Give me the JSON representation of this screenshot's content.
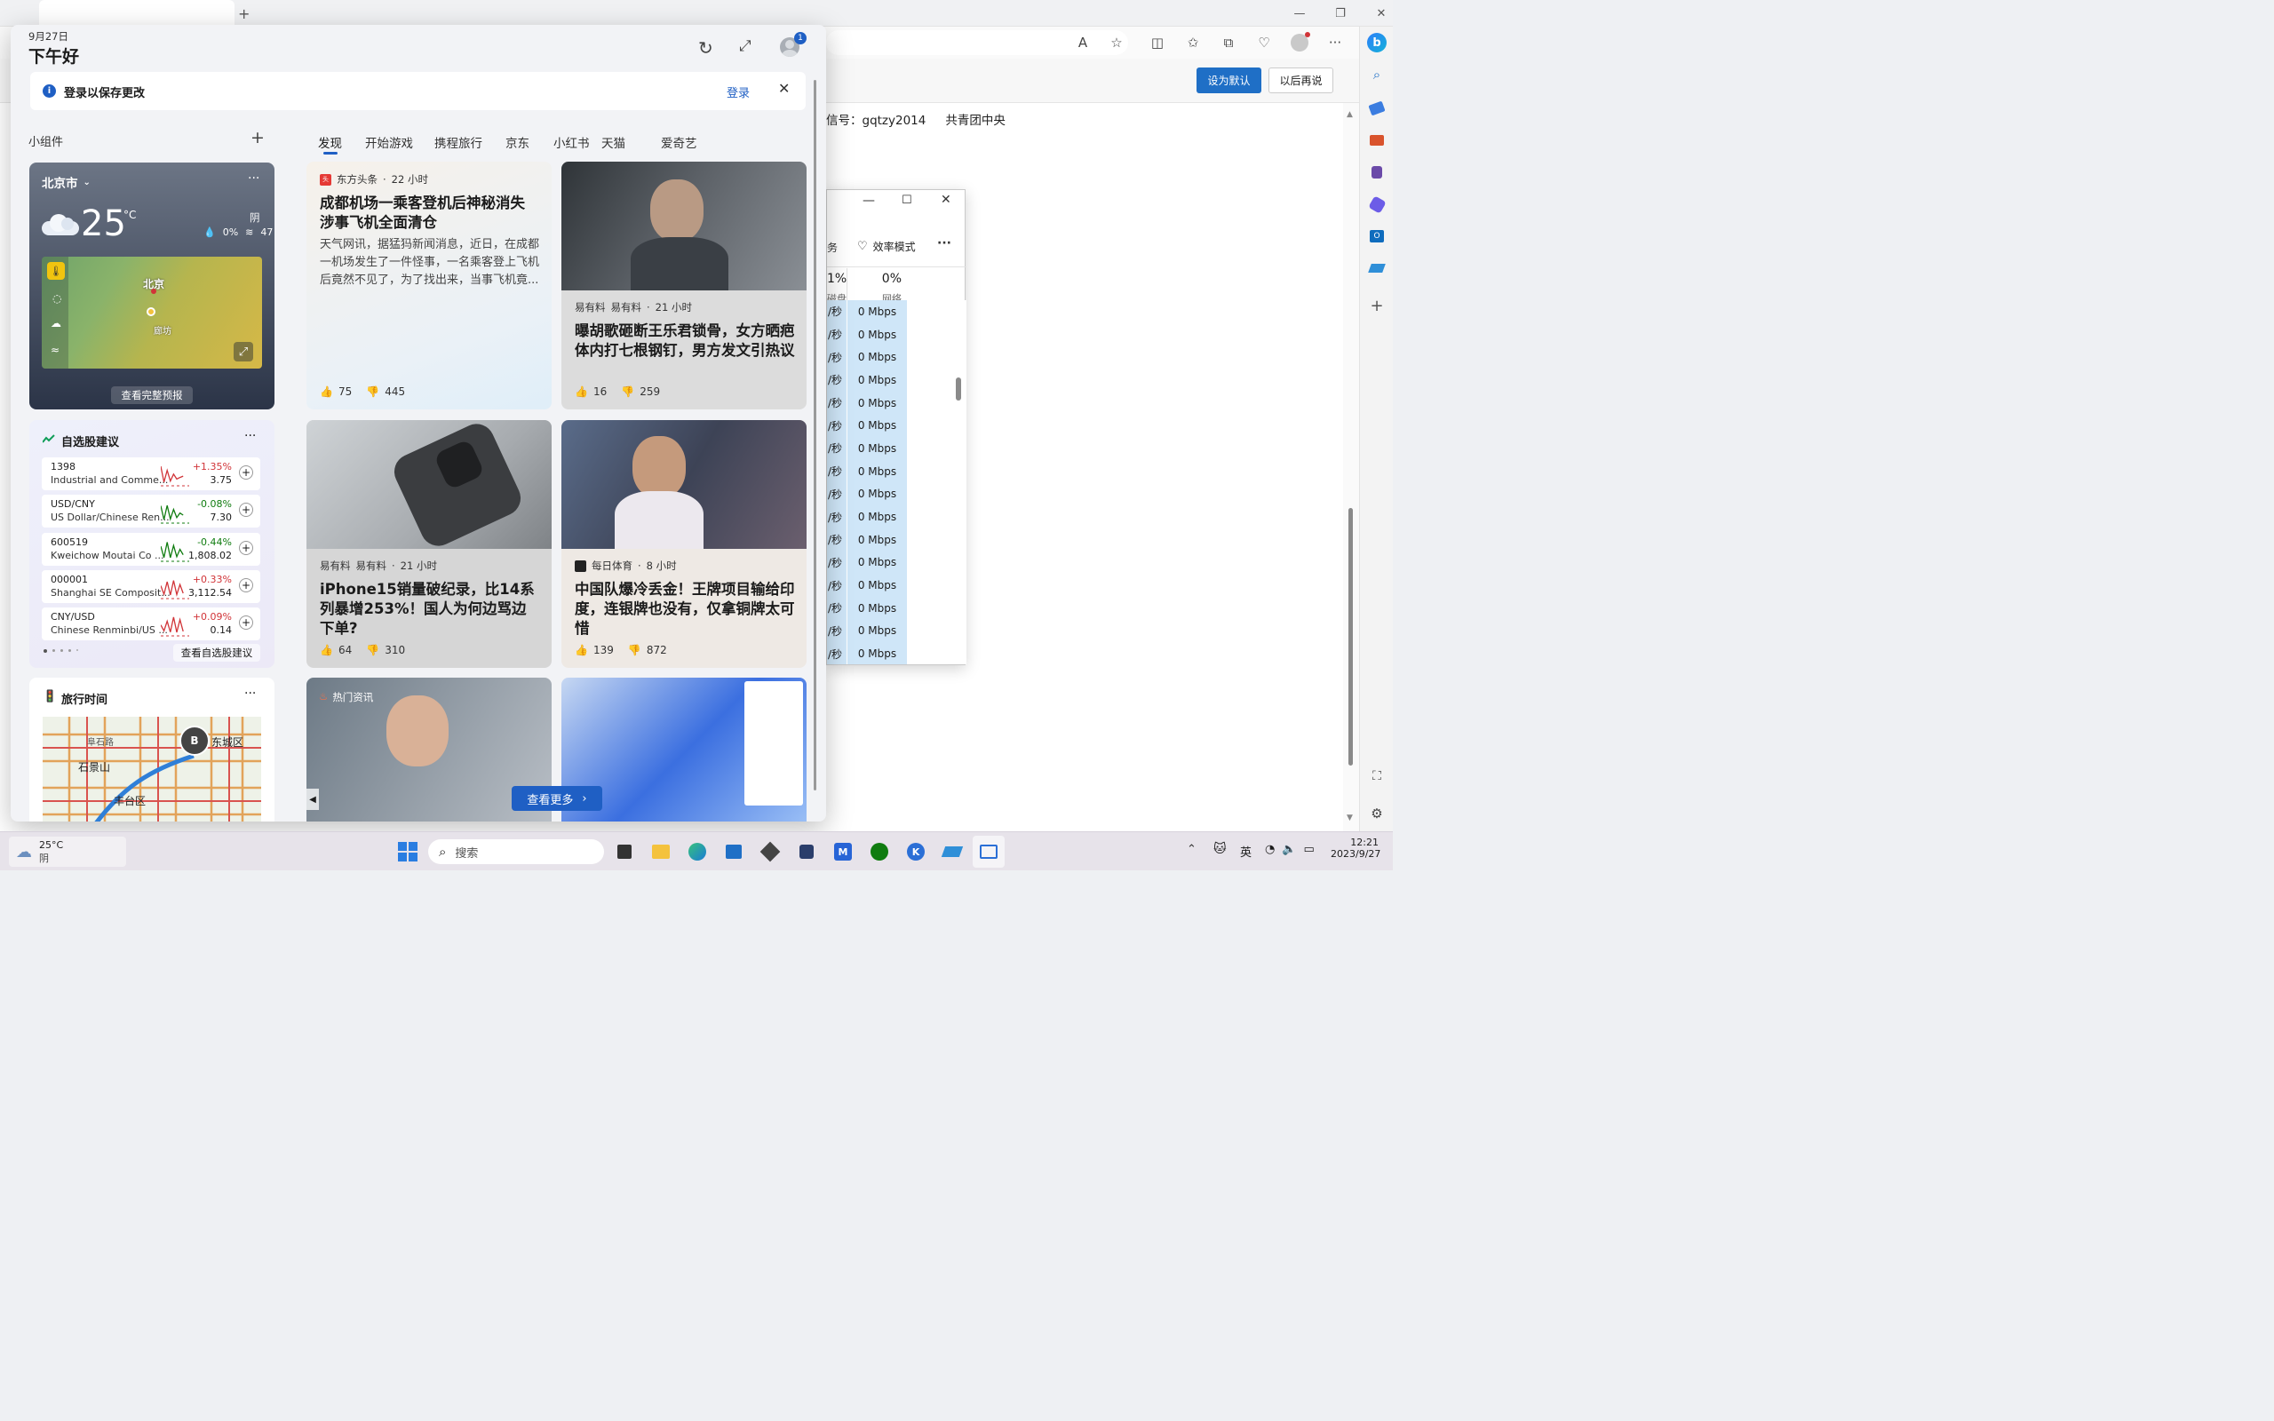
{
  "browser": {
    "tab_title": "...",
    "actions": {
      "set_default": "设为默认",
      "later": "以后再说"
    },
    "page_text": {
      "wechat": "信号：gqtzy2014",
      "org": "共青团中央"
    }
  },
  "taskmgr": {
    "efficiency_mode": "效率模式",
    "tab_partial": "务",
    "disk_percent": "1%",
    "disk_label": "磁盘",
    "net_percent": "0%",
    "net_label": "网络",
    "rate_unit": "/秒",
    "rows": [
      "0 Mbps",
      "0 Mbps",
      "0 Mbps",
      "0 Mbps",
      "0 Mbps",
      "0 Mbps",
      "0 Mbps",
      "0 Mbps",
      "0 Mbps",
      "0 Mbps",
      "0 Mbps",
      "0 Mbps",
      "0 Mbps",
      "0 Mbps",
      "0 Mbps",
      "0 Mbps"
    ]
  },
  "widgets": {
    "date": "9月27日",
    "greeting": "下午好",
    "notification_badge": "1",
    "signin_bar": {
      "message": "登录以保存更改",
      "action": "登录"
    },
    "widgets_label": "小组件",
    "tabs": [
      "发现",
      "开始游戏",
      "携程旅行",
      "京东",
      "小红书",
      "天猫",
      "爱奇艺"
    ],
    "weather": {
      "city": "北京市",
      "temp": "25",
      "unit": "°C",
      "condition": "阴",
      "precip": "0%",
      "humidity": "47",
      "map_label_city": "北京",
      "map_label_town": "廊坊",
      "footer": "查看完整预报"
    },
    "stocks": {
      "title": "自选股建议",
      "footer": "查看自选股建议",
      "items": [
        {
          "symbol": "1398",
          "name": "Industrial and Comme...",
          "change": "+1.35%",
          "price": "3.75",
          "dir": "up"
        },
        {
          "symbol": "USD/CNY",
          "name": "US Dollar/Chinese Ren...",
          "change": "-0.08%",
          "price": "7.30",
          "dir": "down"
        },
        {
          "symbol": "600519",
          "name": "Kweichow Moutai Co ...",
          "change": "-0.44%",
          "price": "1,808.02",
          "dir": "down"
        },
        {
          "symbol": "000001",
          "name": "Shanghai SE Composit...",
          "change": "+0.33%",
          "price": "3,112.54",
          "dir": "up"
        },
        {
          "symbol": "CNY/USD",
          "name": "Chinese Renminbi/US ...",
          "change": "+0.09%",
          "price": "0.14",
          "dir": "up"
        }
      ]
    },
    "traffic": {
      "title": "旅行时间",
      "map_labels": [
        "东城区",
        "石景山",
        "丰台区",
        "阜石路"
      ],
      "pin": "B"
    },
    "news": [
      {
        "source": "东方头条",
        "time": "22 小时",
        "title": "成都机场一乘客登机后神秘消失 涉事飞机全面清仓",
        "snippet": "天气网讯，据猛犸新闻消息，近日，在成都一机场发生了一件怪事，一名乘客登上飞机后竟然不见了，为了找出来，当事飞机竟...",
        "likes": "75",
        "dislikes": "445"
      },
      {
        "source": "易有料",
        "source_alt": "易有料",
        "time": "21 小时",
        "title": "曝胡歌砸断王乐君锁骨，女方晒疤体内打七根钢钉，男方发文引热议",
        "likes": "16",
        "dislikes": "259"
      },
      {
        "source": "易有料",
        "source_alt": "易有料",
        "time": "21 小时",
        "title": "iPhone15销量破纪录，比14系列暴增253%！国人为何边骂边下单?",
        "likes": "64",
        "dislikes": "310"
      },
      {
        "source": "每日体育",
        "time": "8 小时",
        "title": "中国队爆冷丢金！王牌项目输给印度，连银牌也没有，仅拿铜牌太可惜",
        "likes": "139",
        "dislikes": "872"
      },
      {
        "source": "热门资讯"
      }
    ],
    "see_more": "查看更多"
  },
  "taskbar": {
    "weather_temp": "25°C",
    "weather_cond": "阴",
    "search_placeholder": "搜索",
    "ime": "英",
    "time": "12:21",
    "date": "2023/9/27"
  }
}
